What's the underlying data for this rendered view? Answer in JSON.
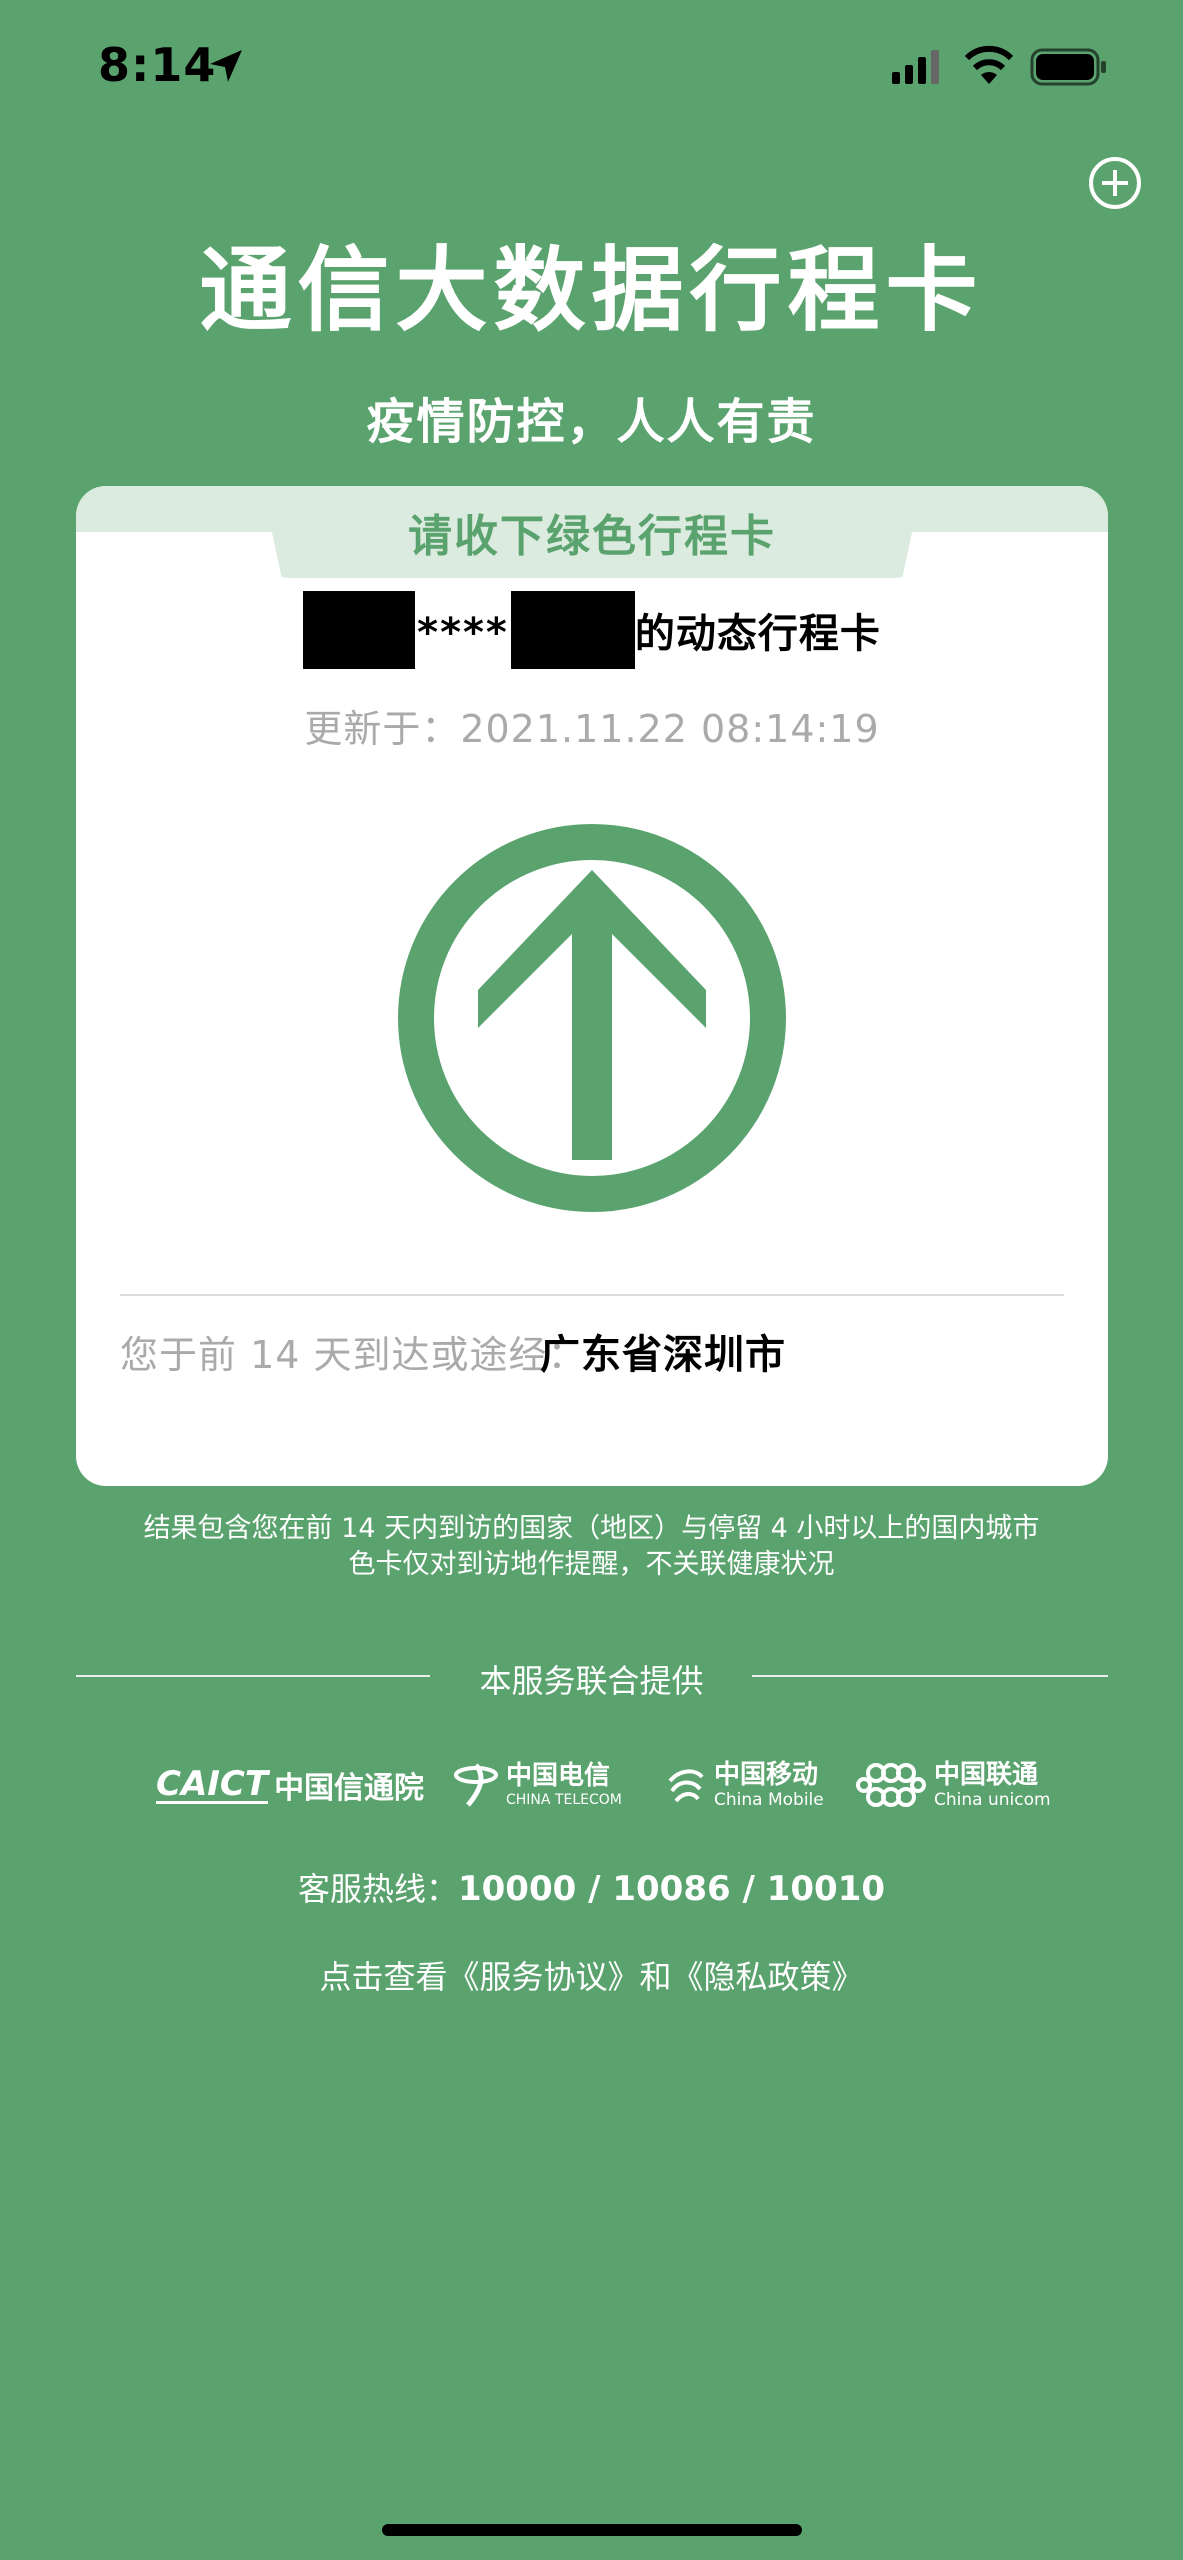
{
  "status_bar": {
    "time": "8:14"
  },
  "header": {
    "title": "通信大数据行程卡",
    "subtitle": "疫情防控，人人有责"
  },
  "card": {
    "tab_title": "请收下绿色行程卡",
    "phone_mask": "****",
    "name_suffix": "的动态行程卡",
    "updated": "更新于：2021.11.22 08:14:19",
    "status_color": "#5ba36e",
    "status_icon": "up-arrow-in-circle",
    "route_label": "您于前 14 天到达或途经：",
    "route_city": "广东省深圳市"
  },
  "notes": {
    "line1": "结果包含您在前 14 天内到访的国家（地区）与停留 4 小时以上的国内城市",
    "line2": "色卡仅对到访地作提醒，不关联健康状况"
  },
  "providers": {
    "heading": "本服务联合提供",
    "caict_mark": "CAICT",
    "caict_name": "中国信通院",
    "telecom_name": "中国电信",
    "telecom_en": "CHINA TELECOM",
    "mobile_name": "中国移动",
    "mobile_en": "China Mobile",
    "unicom_name": "中国联通",
    "unicom_en": "China unicom"
  },
  "footer": {
    "hotline_label": "客服热线：",
    "hotline_numbers": "10000 / 10086 / 10010",
    "agreement": "点击查看《服务协议》和《隐私政策》"
  },
  "colors": {
    "background": "#5ba36e",
    "card": "#ffffff",
    "tab": "#dcebdf"
  }
}
